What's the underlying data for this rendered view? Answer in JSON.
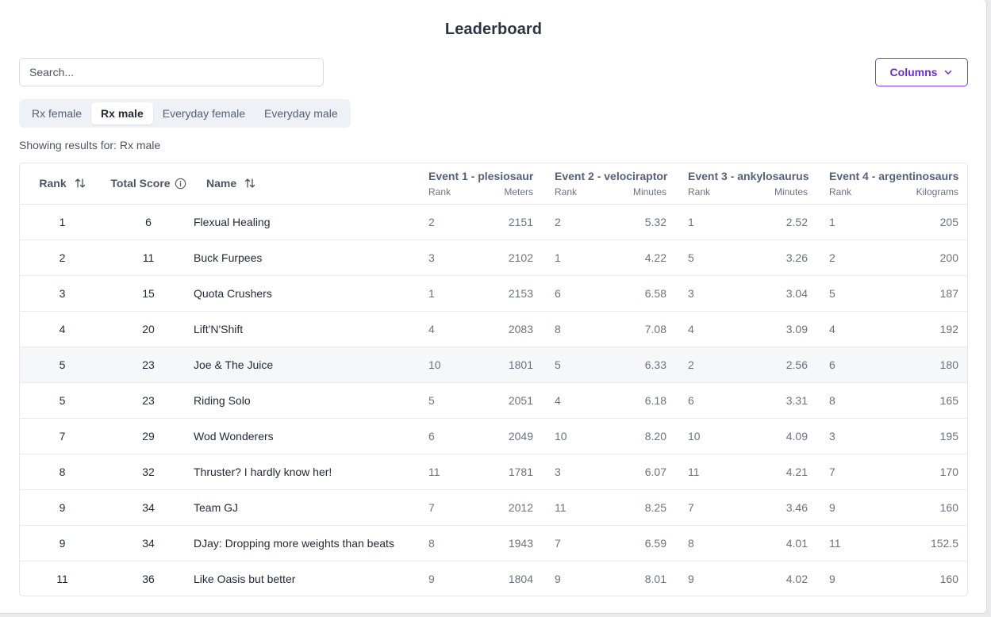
{
  "title": "Leaderboard",
  "search": {
    "placeholder": "Search..."
  },
  "columns_button": {
    "label": "Columns"
  },
  "tabs": [
    {
      "label": "Rx female",
      "active": false
    },
    {
      "label": "Rx male",
      "active": true
    },
    {
      "label": "Everyday female",
      "active": false
    },
    {
      "label": "Everyday male",
      "active": false
    }
  ],
  "showing": "Showing results for: Rx male",
  "table": {
    "headers": {
      "rank": "Rank",
      "total_score": "Total Score",
      "name": "Name"
    },
    "events": [
      {
        "title": "Event 1 - plesiosaur",
        "rank_label": "Rank",
        "unit": "Meters"
      },
      {
        "title": "Event 2 - velociraptor",
        "rank_label": "Rank",
        "unit": "Minutes"
      },
      {
        "title": "Event 3 - ankylosaurus",
        "rank_label": "Rank",
        "unit": "Minutes"
      },
      {
        "title": "Event 4 - argentinosaurs",
        "rank_label": "Rank",
        "unit": "Kilograms"
      }
    ],
    "rows": [
      {
        "rank": "1",
        "score": "6",
        "name": "Flexual Healing",
        "e1r": "2",
        "e1v": "2151",
        "e2r": "2",
        "e2v": "5.32",
        "e3r": "1",
        "e3v": "2.52",
        "e4r": "1",
        "e4v": "205"
      },
      {
        "rank": "2",
        "score": "11",
        "name": "Buck Furpees",
        "e1r": "3",
        "e1v": "2102",
        "e2r": "1",
        "e2v": "4.22",
        "e3r": "5",
        "e3v": "3.26",
        "e4r": "2",
        "e4v": "200"
      },
      {
        "rank": "3",
        "score": "15",
        "name": "Quota Crushers",
        "e1r": "1",
        "e1v": "2153",
        "e2r": "6",
        "e2v": "6.58",
        "e3r": "3",
        "e3v": "3.04",
        "e4r": "5",
        "e4v": "187"
      },
      {
        "rank": "4",
        "score": "20",
        "name": "Lift'N'Shift",
        "e1r": "4",
        "e1v": "2083",
        "e2r": "8",
        "e2v": "7.08",
        "e3r": "4",
        "e3v": "3.09",
        "e4r": "4",
        "e4v": "192"
      },
      {
        "rank": "5",
        "score": "23",
        "name": "Joe & The Juice",
        "e1r": "10",
        "e1v": "1801",
        "e2r": "5",
        "e2v": "6.33",
        "e3r": "2",
        "e3v": "2.56",
        "e4r": "6",
        "e4v": "180",
        "highlight": true
      },
      {
        "rank": "5",
        "score": "23",
        "name": "Riding Solo",
        "e1r": "5",
        "e1v": "2051",
        "e2r": "4",
        "e2v": "6.18",
        "e3r": "6",
        "e3v": "3.31",
        "e4r": "8",
        "e4v": "165"
      },
      {
        "rank": "7",
        "score": "29",
        "name": "Wod Wonderers",
        "e1r": "6",
        "e1v": "2049",
        "e2r": "10",
        "e2v": "8.20",
        "e3r": "10",
        "e3v": "4.09",
        "e4r": "3",
        "e4v": "195"
      },
      {
        "rank": "8",
        "score": "32",
        "name": "Thruster? I hardly know her!",
        "e1r": "11",
        "e1v": "1781",
        "e2r": "3",
        "e2v": "6.07",
        "e3r": "11",
        "e3v": "4.21",
        "e4r": "7",
        "e4v": "170"
      },
      {
        "rank": "9",
        "score": "34",
        "name": "Team GJ",
        "e1r": "7",
        "e1v": "2012",
        "e2r": "11",
        "e2v": "8.25",
        "e3r": "7",
        "e3v": "3.46",
        "e4r": "9",
        "e4v": "160"
      },
      {
        "rank": "9",
        "score": "34",
        "name": "DJay: Dropping more weights than beats",
        "e1r": "8",
        "e1v": "1943",
        "e2r": "7",
        "e2v": "6.59",
        "e3r": "8",
        "e3v": "4.01",
        "e4r": "11",
        "e4v": "152.5"
      },
      {
        "rank": "11",
        "score": "36",
        "name": "Like Oasis but better",
        "e1r": "9",
        "e1v": "1804",
        "e2r": "9",
        "e2v": "8.01",
        "e3r": "9",
        "e3v": "4.02",
        "e4r": "9",
        "e4v": "160"
      }
    ]
  },
  "icons": {
    "sort": "sort-icon",
    "info": "info-icon",
    "chevron": "chevron-down-icon"
  },
  "colors": {
    "accent": "#6d28d9",
    "highlight_row": "#f6f7f9"
  }
}
